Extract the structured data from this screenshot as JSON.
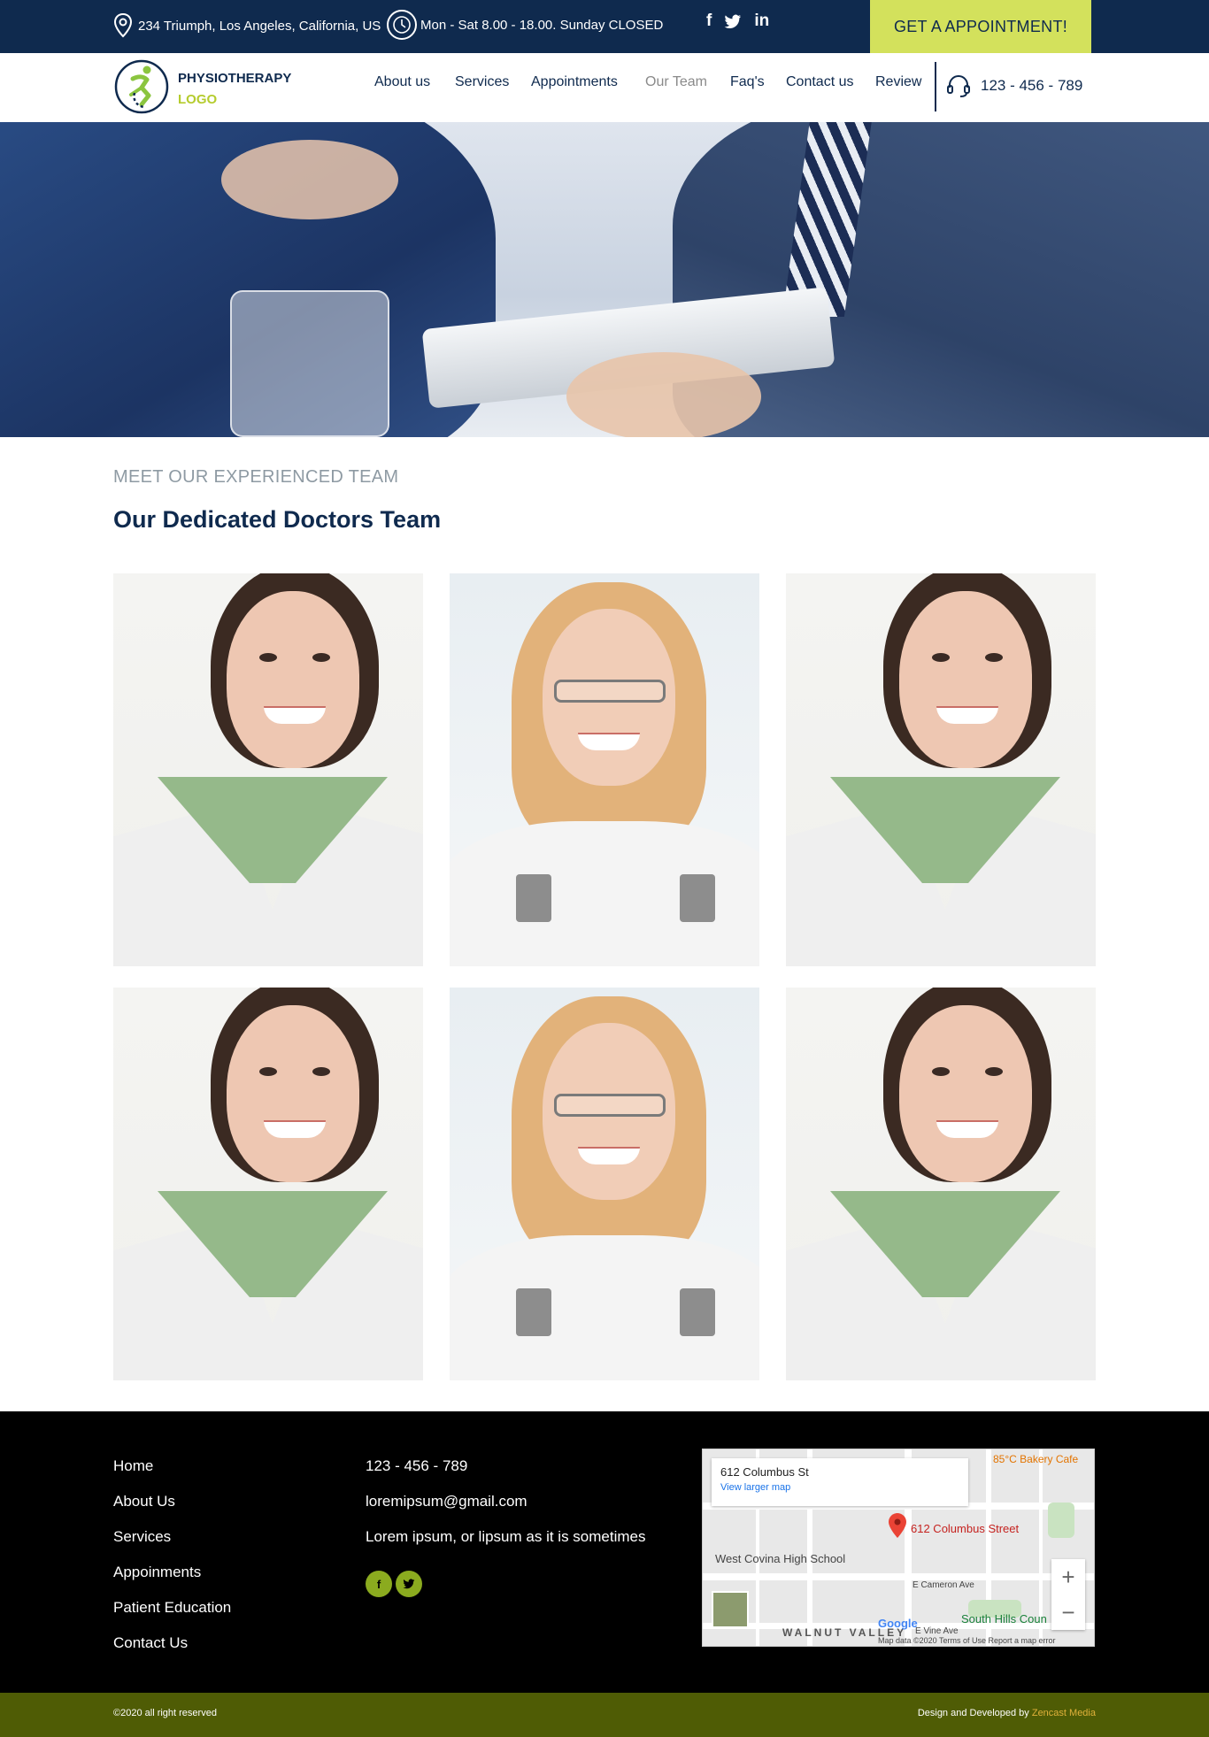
{
  "topbar": {
    "address": "234 Triumph, Los Angeles, California, US",
    "hours": "Mon - Sat 8.00 - 18.00. Sunday CLOSED",
    "social": [
      "f",
      "twitter",
      "in"
    ],
    "cta_label": "GET A APPOINTMENT!"
  },
  "brand": {
    "line1": "PHYSIOTHERAPY",
    "line2": "LOGO"
  },
  "nav": {
    "items": [
      "About us",
      "Services",
      "Appointments",
      "Our Team",
      "Faq's",
      "Contact us",
      "Review"
    ],
    "active": "Our Team",
    "phone": "123 - 456 - 789"
  },
  "team": {
    "eyebrow": "MEET OUR EXPERIENCED TEAM",
    "heading": "Our Dedicated Doctors Team",
    "members": [
      {
        "portrait": "brunette-green-collar"
      },
      {
        "portrait": "blonde-glasses"
      },
      {
        "portrait": "brunette-green-collar"
      },
      {
        "portrait": "brunette-green-collar"
      },
      {
        "portrait": "blonde-glasses"
      },
      {
        "portrait": "brunette-green-collar"
      }
    ]
  },
  "footer": {
    "links": [
      "Home",
      "About Us",
      "Services",
      "Appoinments",
      "Patient Education",
      "Contact Us"
    ],
    "phone": "123 - 456 - 789",
    "email": "loremipsum@gmail.com",
    "tagline": "Lorem ipsum, or lipsum as it is sometimes",
    "social": [
      "f",
      "twitter"
    ]
  },
  "map": {
    "place": "612 Columbus St",
    "larger_link": "View larger map",
    "marker_label": "612 Columbus Street",
    "labels": {
      "bakery": "85°C Bakery Cafe",
      "school": "West Covina High School",
      "hills": "South Hills Coun",
      "walnut": "WALNUT VALLEY",
      "cameron": "E Cameron Ave",
      "vine": "E Vine Ave",
      "google": "Google",
      "attribution": "Map data ©2020   Terms of Use   Report a map error"
    }
  },
  "bottom": {
    "copyright": "©2020 all right reserved",
    "credit_prefix": "Design and Developed by ",
    "credit_brand": "Zencast Media"
  },
  "colors": {
    "navy": "#0f2a4e",
    "lime": "#d3e15c",
    "olive": "#4f5c05",
    "footer_bg": "#000000"
  }
}
